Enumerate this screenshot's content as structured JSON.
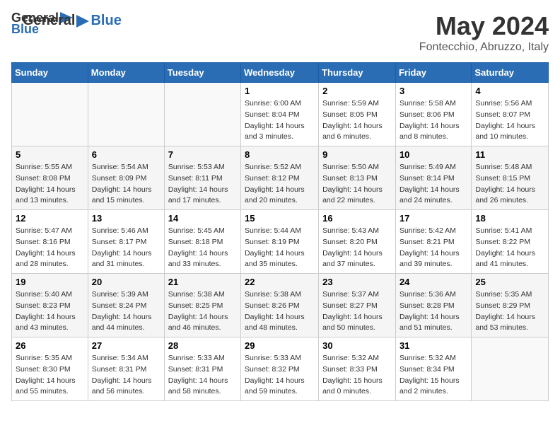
{
  "header": {
    "logo_general": "General",
    "logo_blue": "Blue",
    "month": "May 2024",
    "location": "Fontecchio, Abruzzo, Italy"
  },
  "weekdays": [
    "Sunday",
    "Monday",
    "Tuesday",
    "Wednesday",
    "Thursday",
    "Friday",
    "Saturday"
  ],
  "weeks": [
    [
      {
        "day": "",
        "sunrise": "",
        "sunset": "",
        "daylight": ""
      },
      {
        "day": "",
        "sunrise": "",
        "sunset": "",
        "daylight": ""
      },
      {
        "day": "",
        "sunrise": "",
        "sunset": "",
        "daylight": ""
      },
      {
        "day": "1",
        "sunrise": "Sunrise: 6:00 AM",
        "sunset": "Sunset: 8:04 PM",
        "daylight": "Daylight: 14 hours and 3 minutes."
      },
      {
        "day": "2",
        "sunrise": "Sunrise: 5:59 AM",
        "sunset": "Sunset: 8:05 PM",
        "daylight": "Daylight: 14 hours and 6 minutes."
      },
      {
        "day": "3",
        "sunrise": "Sunrise: 5:58 AM",
        "sunset": "Sunset: 8:06 PM",
        "daylight": "Daylight: 14 hours and 8 minutes."
      },
      {
        "day": "4",
        "sunrise": "Sunrise: 5:56 AM",
        "sunset": "Sunset: 8:07 PM",
        "daylight": "Daylight: 14 hours and 10 minutes."
      }
    ],
    [
      {
        "day": "5",
        "sunrise": "Sunrise: 5:55 AM",
        "sunset": "Sunset: 8:08 PM",
        "daylight": "Daylight: 14 hours and 13 minutes."
      },
      {
        "day": "6",
        "sunrise": "Sunrise: 5:54 AM",
        "sunset": "Sunset: 8:09 PM",
        "daylight": "Daylight: 14 hours and 15 minutes."
      },
      {
        "day": "7",
        "sunrise": "Sunrise: 5:53 AM",
        "sunset": "Sunset: 8:11 PM",
        "daylight": "Daylight: 14 hours and 17 minutes."
      },
      {
        "day": "8",
        "sunrise": "Sunrise: 5:52 AM",
        "sunset": "Sunset: 8:12 PM",
        "daylight": "Daylight: 14 hours and 20 minutes."
      },
      {
        "day": "9",
        "sunrise": "Sunrise: 5:50 AM",
        "sunset": "Sunset: 8:13 PM",
        "daylight": "Daylight: 14 hours and 22 minutes."
      },
      {
        "day": "10",
        "sunrise": "Sunrise: 5:49 AM",
        "sunset": "Sunset: 8:14 PM",
        "daylight": "Daylight: 14 hours and 24 minutes."
      },
      {
        "day": "11",
        "sunrise": "Sunrise: 5:48 AM",
        "sunset": "Sunset: 8:15 PM",
        "daylight": "Daylight: 14 hours and 26 minutes."
      }
    ],
    [
      {
        "day": "12",
        "sunrise": "Sunrise: 5:47 AM",
        "sunset": "Sunset: 8:16 PM",
        "daylight": "Daylight: 14 hours and 28 minutes."
      },
      {
        "day": "13",
        "sunrise": "Sunrise: 5:46 AM",
        "sunset": "Sunset: 8:17 PM",
        "daylight": "Daylight: 14 hours and 31 minutes."
      },
      {
        "day": "14",
        "sunrise": "Sunrise: 5:45 AM",
        "sunset": "Sunset: 8:18 PM",
        "daylight": "Daylight: 14 hours and 33 minutes."
      },
      {
        "day": "15",
        "sunrise": "Sunrise: 5:44 AM",
        "sunset": "Sunset: 8:19 PM",
        "daylight": "Daylight: 14 hours and 35 minutes."
      },
      {
        "day": "16",
        "sunrise": "Sunrise: 5:43 AM",
        "sunset": "Sunset: 8:20 PM",
        "daylight": "Daylight: 14 hours and 37 minutes."
      },
      {
        "day": "17",
        "sunrise": "Sunrise: 5:42 AM",
        "sunset": "Sunset: 8:21 PM",
        "daylight": "Daylight: 14 hours and 39 minutes."
      },
      {
        "day": "18",
        "sunrise": "Sunrise: 5:41 AM",
        "sunset": "Sunset: 8:22 PM",
        "daylight": "Daylight: 14 hours and 41 minutes."
      }
    ],
    [
      {
        "day": "19",
        "sunrise": "Sunrise: 5:40 AM",
        "sunset": "Sunset: 8:23 PM",
        "daylight": "Daylight: 14 hours and 43 minutes."
      },
      {
        "day": "20",
        "sunrise": "Sunrise: 5:39 AM",
        "sunset": "Sunset: 8:24 PM",
        "daylight": "Daylight: 14 hours and 44 minutes."
      },
      {
        "day": "21",
        "sunrise": "Sunrise: 5:38 AM",
        "sunset": "Sunset: 8:25 PM",
        "daylight": "Daylight: 14 hours and 46 minutes."
      },
      {
        "day": "22",
        "sunrise": "Sunrise: 5:38 AM",
        "sunset": "Sunset: 8:26 PM",
        "daylight": "Daylight: 14 hours and 48 minutes."
      },
      {
        "day": "23",
        "sunrise": "Sunrise: 5:37 AM",
        "sunset": "Sunset: 8:27 PM",
        "daylight": "Daylight: 14 hours and 50 minutes."
      },
      {
        "day": "24",
        "sunrise": "Sunrise: 5:36 AM",
        "sunset": "Sunset: 8:28 PM",
        "daylight": "Daylight: 14 hours and 51 minutes."
      },
      {
        "day": "25",
        "sunrise": "Sunrise: 5:35 AM",
        "sunset": "Sunset: 8:29 PM",
        "daylight": "Daylight: 14 hours and 53 minutes."
      }
    ],
    [
      {
        "day": "26",
        "sunrise": "Sunrise: 5:35 AM",
        "sunset": "Sunset: 8:30 PM",
        "daylight": "Daylight: 14 hours and 55 minutes."
      },
      {
        "day": "27",
        "sunrise": "Sunrise: 5:34 AM",
        "sunset": "Sunset: 8:31 PM",
        "daylight": "Daylight: 14 hours and 56 minutes."
      },
      {
        "day": "28",
        "sunrise": "Sunrise: 5:33 AM",
        "sunset": "Sunset: 8:31 PM",
        "daylight": "Daylight: 14 hours and 58 minutes."
      },
      {
        "day": "29",
        "sunrise": "Sunrise: 5:33 AM",
        "sunset": "Sunset: 8:32 PM",
        "daylight": "Daylight: 14 hours and 59 minutes."
      },
      {
        "day": "30",
        "sunrise": "Sunrise: 5:32 AM",
        "sunset": "Sunset: 8:33 PM",
        "daylight": "Daylight: 15 hours and 0 minutes."
      },
      {
        "day": "31",
        "sunrise": "Sunrise: 5:32 AM",
        "sunset": "Sunset: 8:34 PM",
        "daylight": "Daylight: 15 hours and 2 minutes."
      },
      {
        "day": "",
        "sunrise": "",
        "sunset": "",
        "daylight": ""
      }
    ]
  ]
}
